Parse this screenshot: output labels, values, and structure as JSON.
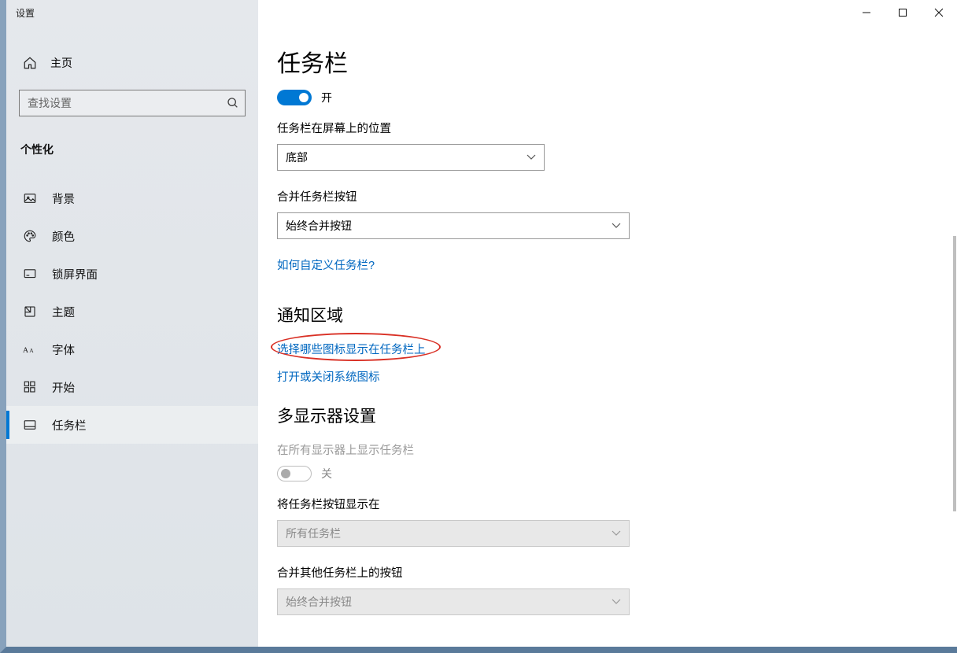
{
  "window": {
    "title": "设置"
  },
  "sidebar": {
    "home_label": "主页",
    "search_placeholder": "查找设置",
    "category": "个性化",
    "items": [
      {
        "label": "背景"
      },
      {
        "label": "颜色"
      },
      {
        "label": "锁屏界面"
      },
      {
        "label": "主题"
      },
      {
        "label": "字体"
      },
      {
        "label": "开始"
      },
      {
        "label": "任务栏"
      }
    ]
  },
  "main": {
    "page_title": "任务栏",
    "toggle1_state": "开",
    "position_label": "任务栏在屏幕上的位置",
    "position_value": "底部",
    "combine_label": "合并任务栏按钮",
    "combine_value": "始终合并按钮",
    "customize_link": "如何自定义任务栏?",
    "section_notification": "通知区域",
    "select_icons_link": "选择哪些图标显示在任务栏上",
    "system_icons_link": "打开或关闭系统图标",
    "section_multi": "多显示器设置",
    "multi_show_label": "在所有显示器上显示任务栏",
    "multi_toggle_state": "关",
    "multi_buttons_label": "将任务栏按钮显示在",
    "multi_buttons_value": "所有任务栏",
    "multi_combine_label": "合并其他任务栏上的按钮",
    "multi_combine_value": "始终合并按钮"
  }
}
